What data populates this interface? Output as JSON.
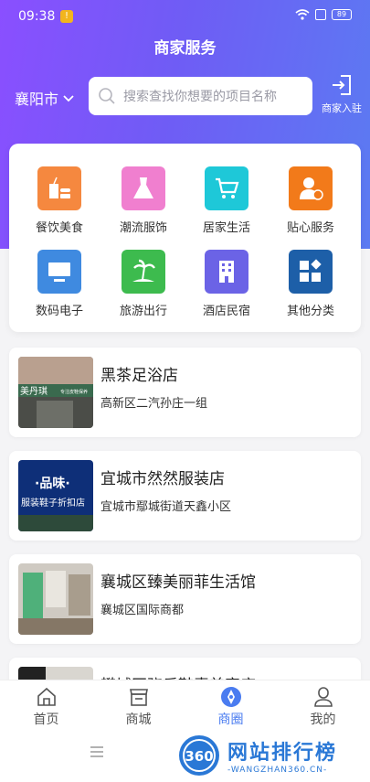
{
  "status": {
    "time": "09:38",
    "battery": "89"
  },
  "header": {
    "title": "商家服务",
    "city": "襄阳市",
    "search_placeholder": "搜索查找你想要的项目名称",
    "merchant_entry": "商家入驻"
  },
  "categories": [
    {
      "label": "餐饮美食",
      "icon": "food-drink-icon",
      "color": "#f5883f"
    },
    {
      "label": "潮流服饰",
      "icon": "dress-icon",
      "color": "#f07fcf"
    },
    {
      "label": "居家生活",
      "icon": "shopping-cart-icon",
      "color": "#1ec8d8"
    },
    {
      "label": "贴心服务",
      "icon": "service-person-icon",
      "color": "#f27a1a"
    },
    {
      "label": "数码电子",
      "icon": "computer-icon",
      "color": "#3f8ae0"
    },
    {
      "label": "旅游出行",
      "icon": "island-icon",
      "color": "#3dbb4e"
    },
    {
      "label": "酒店民宿",
      "icon": "hotel-icon",
      "color": "#6b63e6"
    },
    {
      "label": "其他分类",
      "icon": "grid-more-icon",
      "color": "#1d5fa8"
    }
  ],
  "shops": [
    {
      "name": "黑茶足浴店",
      "address": "高新区二汽孙庄一组"
    },
    {
      "name": "宜城市然然服装店",
      "address": "宜城市鄢城街道天鑫小区"
    },
    {
      "name": "襄城区臻美丽菲生活馆",
      "address": "襄城区国际商都"
    },
    {
      "name": "樊城区骁乐鞋素美容店",
      "address": ""
    }
  ],
  "shop_thumb_text": {
    "shop1": "美丹琪",
    "shop1_sub": "专注皮鞋保养",
    "shop2_line1": "·品味·",
    "shop2_line2": "服装鞋子折扣店"
  },
  "tabs": [
    {
      "label": "首页",
      "icon": "home-icon",
      "active": false
    },
    {
      "label": "商城",
      "icon": "store-icon",
      "active": false
    },
    {
      "label": "商圈",
      "icon": "compass-icon",
      "active": true
    },
    {
      "label": "我的",
      "icon": "user-icon",
      "active": false
    }
  ],
  "watermark": {
    "number": "360",
    "main": "网站排行榜",
    "sub": "-WANGZHAN360.CN-"
  },
  "colors": {
    "accent": "#4a7cf0",
    "hero_start": "#8a4fff",
    "hero_end": "#5b7bf2"
  }
}
